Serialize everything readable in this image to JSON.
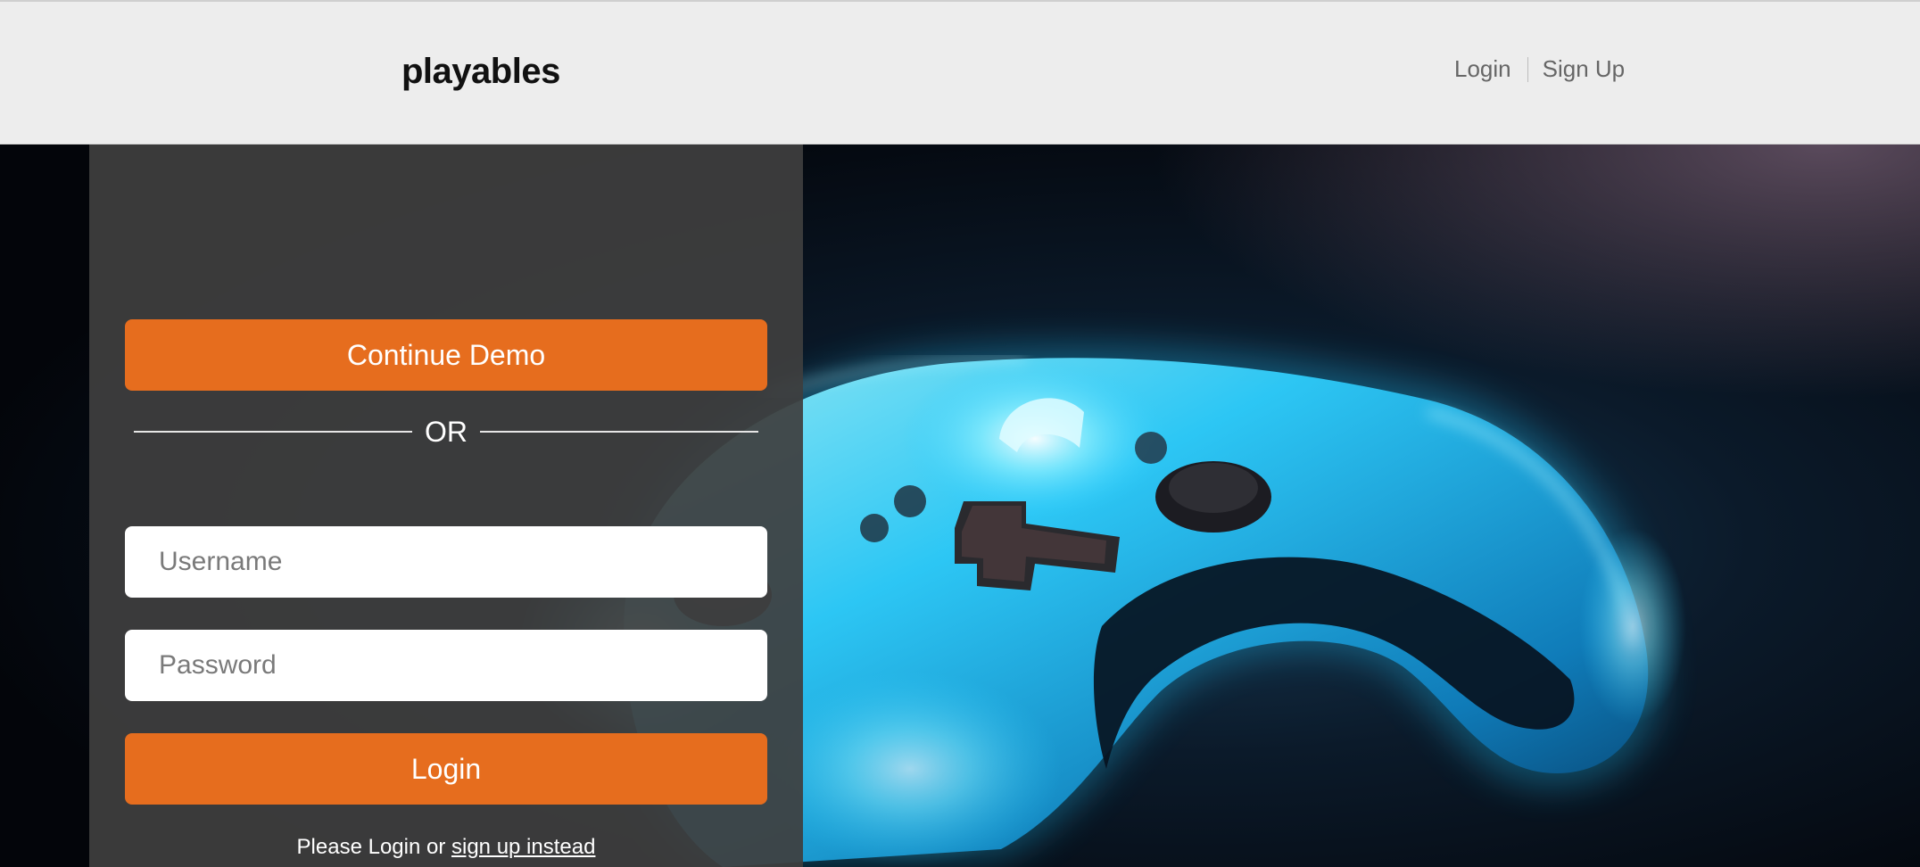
{
  "header": {
    "brand": "playables",
    "nav": {
      "login_label": "Login",
      "signup_label": "Sign Up"
    }
  },
  "login_panel": {
    "demo_button_label": "Continue Demo",
    "divider_text": "OR",
    "username": {
      "placeholder": "Username",
      "value": ""
    },
    "password": {
      "placeholder": "Password",
      "value": ""
    },
    "login_button_label": "Login",
    "hint_prefix": "Please Login or ",
    "hint_link": "sign up instead"
  },
  "colors": {
    "accent": "#e66d1e",
    "header_bg": "#ededed",
    "panel_bg": "#3e3e3e",
    "controller_glow": "#2fd0ff"
  },
  "icons": {
    "hero_background": "game-controller-image"
  }
}
